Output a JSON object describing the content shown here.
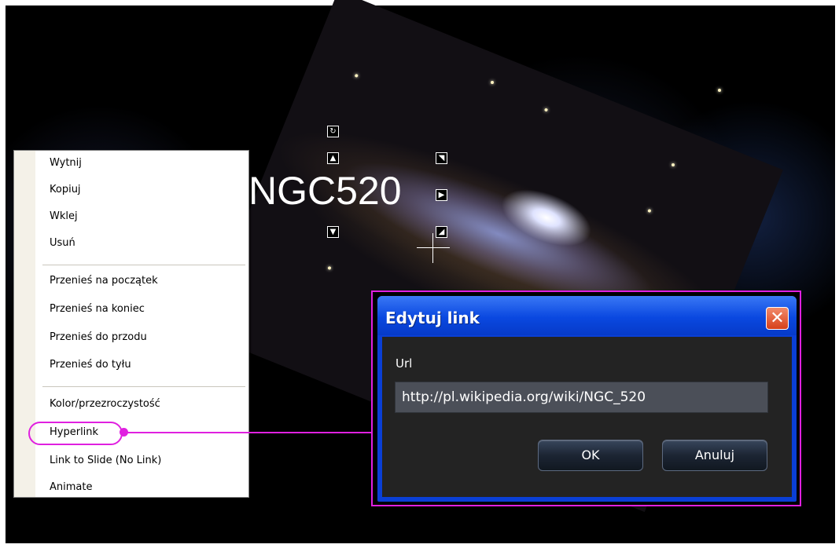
{
  "slide": {
    "title_text": "NGC520"
  },
  "context_menu": {
    "items": [
      {
        "label": "Wytnij"
      },
      {
        "label": "Kopiuj"
      },
      {
        "label": "Wklej"
      },
      {
        "label": "Usuń"
      },
      {
        "label": "Przenieś na początek"
      },
      {
        "label": "Przenieś na koniec"
      },
      {
        "label": "Przenieś do przodu"
      },
      {
        "label": "Przenieś do tyłu"
      },
      {
        "label": "Kolor/przezroczystość"
      },
      {
        "label": "Hyperlink"
      },
      {
        "label": "Link to Slide (No Link)"
      },
      {
        "label": "Animate"
      }
    ],
    "highlighted_item": "Hyperlink",
    "highlight_color": "#e020e0"
  },
  "dialog": {
    "title": "Edytuj link",
    "url_label": "Url",
    "url_value": "http://pl.wikipedia.org/wiki/NGC_520",
    "ok_label": "OK",
    "cancel_label": "Anuluj",
    "close_icon": "close-icon",
    "title_bar_color": "#0a48e0"
  }
}
